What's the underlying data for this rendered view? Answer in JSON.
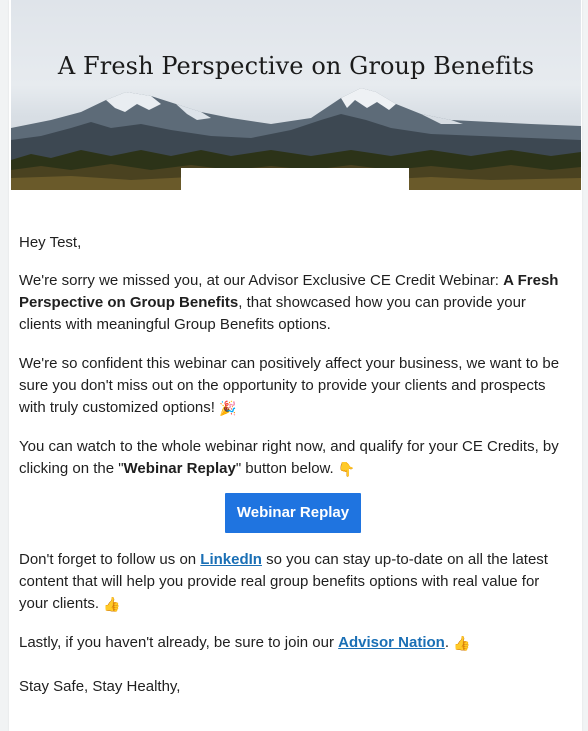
{
  "hero": {
    "title": "A Fresh Perspective on Group Benefits"
  },
  "email": {
    "greeting": "Hey Test,",
    "p1": {
      "intro": "We're sorry we missed you, at our Advisor Exclusive CE Credit Webinar: ",
      "bold": "A Fresh Perspective on Group Benefits",
      "rest": ", that showcased how you can provide your clients with meaningful Group Benefits options."
    },
    "p2": {
      "text": "We're so confident this webinar can positively affect your business, we want to be sure you don't miss out on the opportunity to provide your clients and prospects with truly customized options! ",
      "emoji": "🎉"
    },
    "p3": {
      "intro": "You can watch to the whole webinar right now, and qualify for your CE Credits, by clicking on the \"",
      "bold": "Webinar Replay",
      "rest": "\" button below. ",
      "emoji": "👇"
    },
    "button_label": "Webinar Replay",
    "p4": {
      "intro": "Don't forget to follow us on ",
      "link": "LinkedIn",
      "rest": " so you can stay up-to-date on all the latest content that will help you provide real group benefits options with real value for your clients. ",
      "emoji": "👍"
    },
    "p5": {
      "intro": "Lastly, if you haven't already, be sure to join our ",
      "link": "Advisor Nation",
      "rest": ". ",
      "emoji": "👍"
    },
    "signoff": "Stay Safe, Stay Healthy,"
  },
  "colors": {
    "button_bg": "#1f74e0",
    "link": "#1a6fb5"
  }
}
